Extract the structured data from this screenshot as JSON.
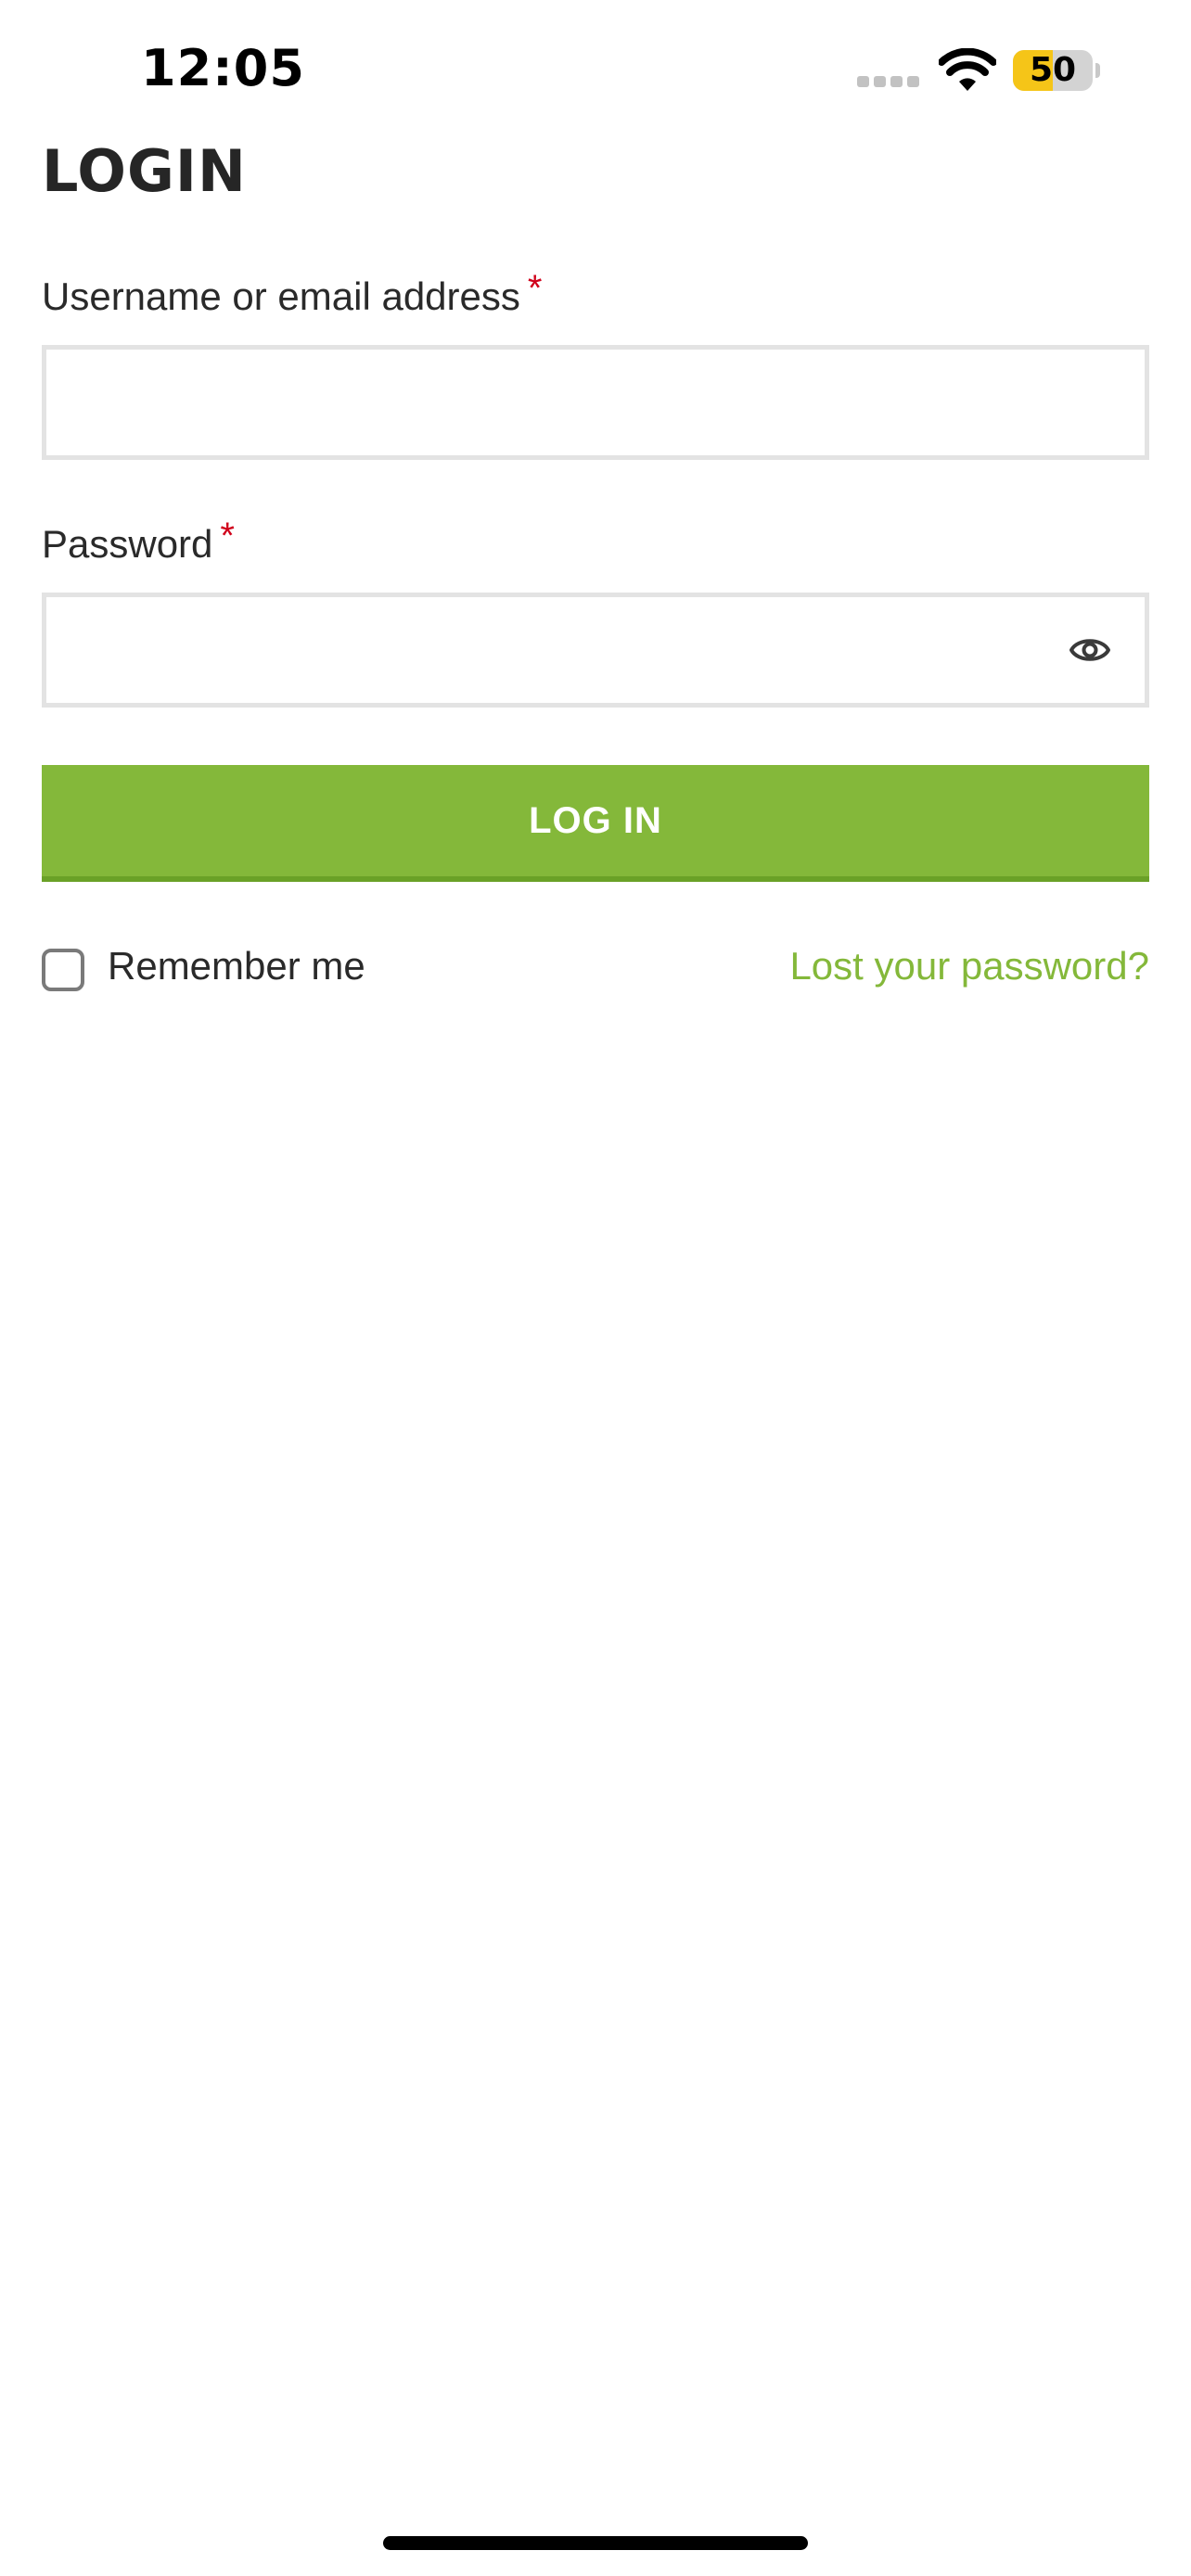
{
  "status_bar": {
    "time": "12:05",
    "battery_percent": "50",
    "battery_level": 0.5,
    "signal_icon": "cellular-signal-dots-icon",
    "wifi_icon": "wifi-icon",
    "battery_color": "#f5c518"
  },
  "login": {
    "title": "LOGIN",
    "username_label": "Username or email address",
    "username_required": "*",
    "username_value": "",
    "password_label": "Password",
    "password_required": "*",
    "password_value": "",
    "show_password_icon": "eye-icon",
    "submit_label": "LOG IN",
    "remember_label": "Remember me",
    "remember_checked": false,
    "lost_password_label": "Lost your password?"
  },
  "colors": {
    "accent": "#84b83a",
    "accent_dark": "#6aa127",
    "required": "#d0021b",
    "input_border": "#e3e3e3",
    "text": "#2a2a2a"
  }
}
